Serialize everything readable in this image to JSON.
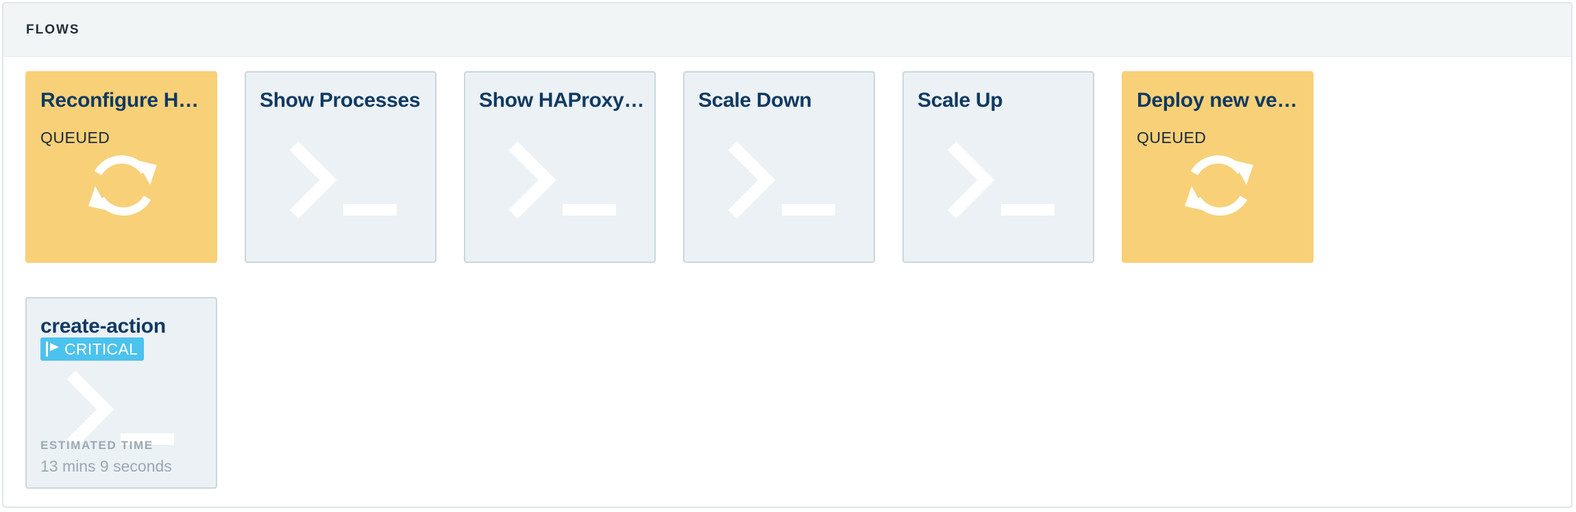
{
  "panel": {
    "title": "FLOWS"
  },
  "flows": [
    {
      "title": "Reconfigure HAP...",
      "status": "QUEUED"
    },
    {
      "title": "Show Processes"
    },
    {
      "title": "Show HAProxy C..."
    },
    {
      "title": "Scale Down"
    },
    {
      "title": "Scale Up"
    },
    {
      "title": "Deploy new versi...",
      "status": "QUEUED"
    },
    {
      "title": "create-action",
      "badge": "CRITICAL",
      "estimate_label": "ESTIMATED TIME",
      "estimate_value": "13 mins 9 seconds"
    }
  ],
  "icons": {
    "queued": "sync-icon",
    "idle": "terminal-prompt-icon",
    "badge": "flag-icon"
  },
  "colors": {
    "queued_card": "#f8d078",
    "idle_card": "#ebf1f4",
    "title": "#0f3a63",
    "badge": "#4cc2ee"
  }
}
